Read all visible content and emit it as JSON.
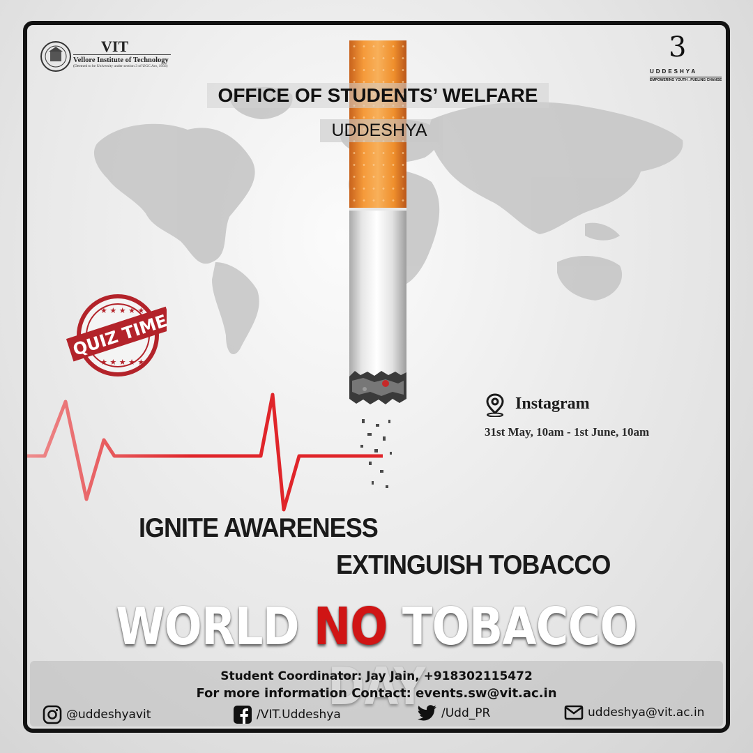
{
  "header": {
    "vit_name": "VIT",
    "vit_full": "Vellore Institute of Technology",
    "vit_deemed": "(Deemed to be University under section 3 of UGC Act, 1956)",
    "uddeshya_mark": "3",
    "uddeshya_name": "UDDESHYA",
    "uddeshya_tagline": "EMPOWERING YOUTH . FUELING CHANGE",
    "office": "OFFICE OF STUDENTS’ WELFARE",
    "department": "UDDESHYA"
  },
  "stamp": {
    "text": "QUIZ TIME",
    "color": "#b3232a"
  },
  "event": {
    "location_icon": "map-pin-icon",
    "platform": "Instagram",
    "datetime": "31st May, 10am - 1st June, 10am"
  },
  "slogan": {
    "line1": "IGNITE AWARENESS",
    "line2": "EXTINGUISH TOBACCO"
  },
  "title": {
    "part1": "WORLD ",
    "highlight": "NO",
    "part2": " TOBACCO DAY",
    "highlight_color": "#d01515"
  },
  "footer": {
    "coordinator": "Student Coordinator: Jay Jain, +918302115472",
    "contact": "For more information Contact: events.sw@vit.ac.in",
    "socials": [
      {
        "icon": "instagram-icon",
        "text": "@uddeshyavit"
      },
      {
        "icon": "facebook-icon",
        "text": "/VIT.Uddeshya"
      },
      {
        "icon": "twitter-icon",
        "text": "/Udd_PR"
      },
      {
        "icon": "mail-icon",
        "text": "uddeshya@vit.ac.in"
      }
    ]
  },
  "colors": {
    "frame": "#121212",
    "heartbeat": "#e0252a",
    "filter": "#f59a3a"
  }
}
